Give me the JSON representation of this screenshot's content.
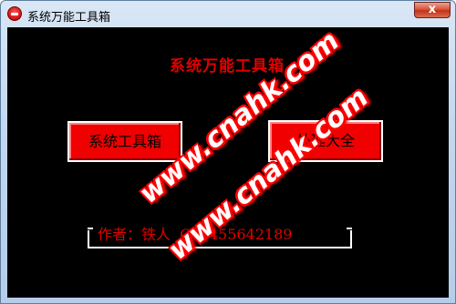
{
  "window": {
    "title": "系统万能工具箱",
    "close_label": "x"
  },
  "main": {
    "heading": "系统万能工具箱",
    "left_button_label": "系统工具箱",
    "right_button_label": "处理大全",
    "author_text": "作者：",
    "author_name": "铁人",
    "qq_text": "QQ:455642189"
  },
  "watermark": {
    "line1": "www.cnahk.com",
    "line2": "www.cnahk.com"
  },
  "colors": {
    "accent": "#e00000",
    "button_bg": "#f00000",
    "client_bg": "#000000"
  }
}
